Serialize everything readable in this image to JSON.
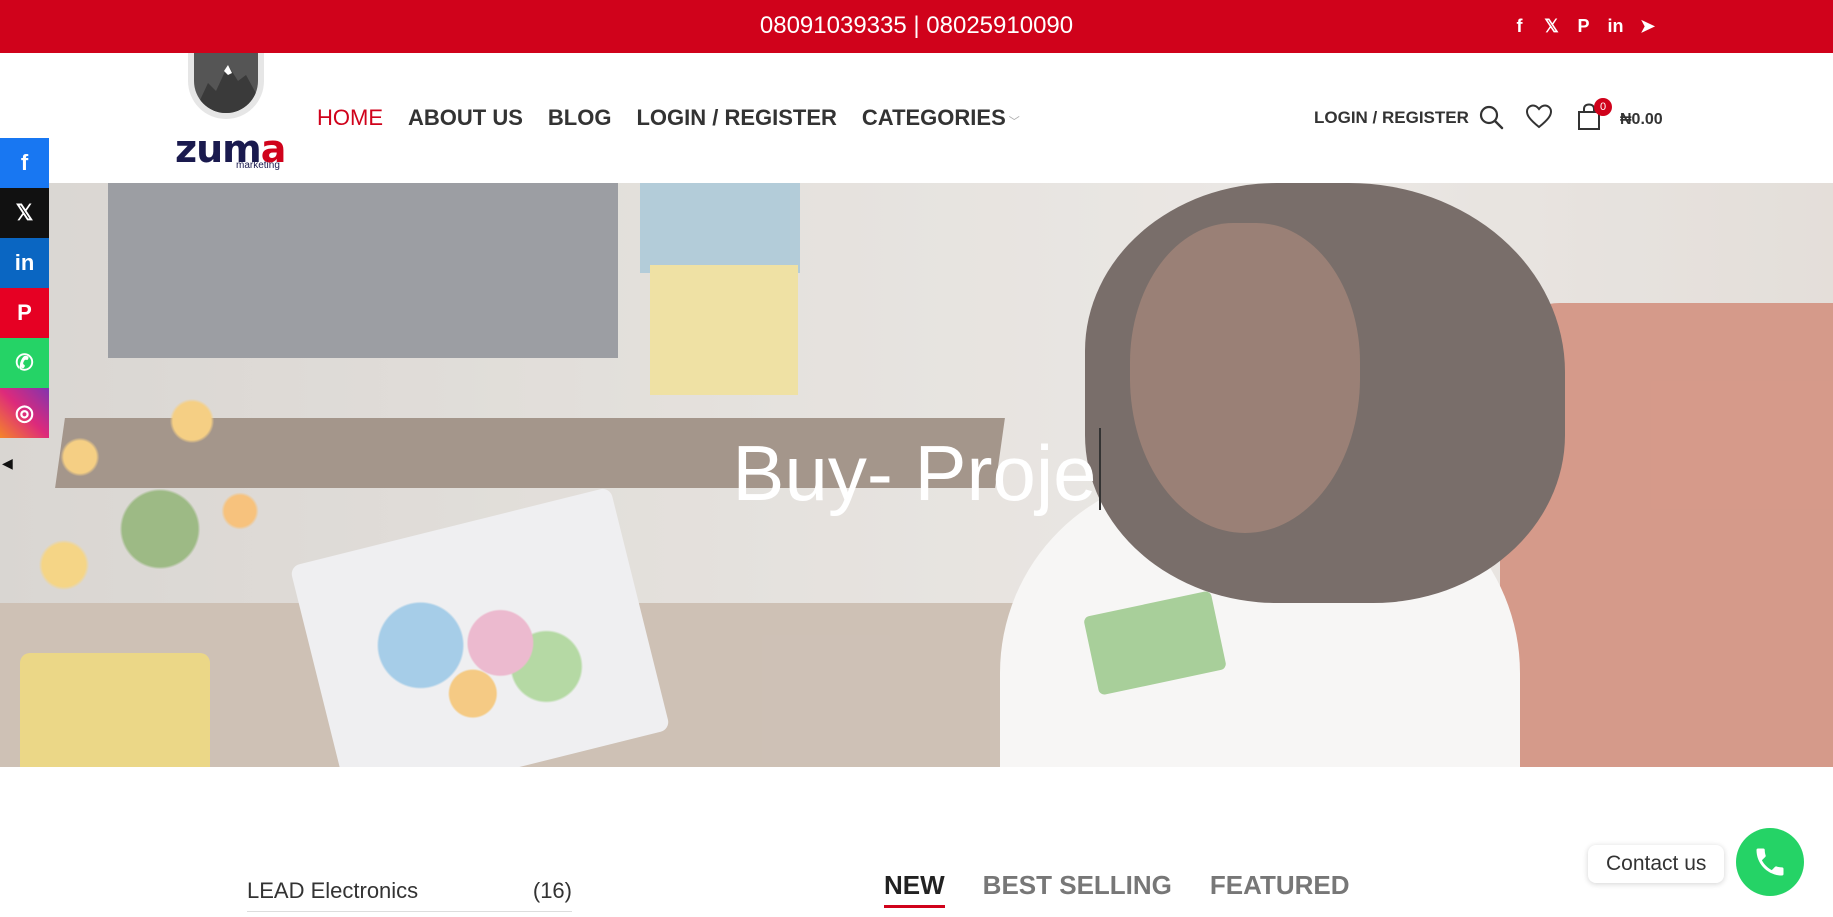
{
  "topbar": {
    "phones": "08091039335 | 08025910090",
    "social": [
      {
        "icon": "facebook-icon",
        "glyph": "f"
      },
      {
        "icon": "x-icon",
        "glyph": "𝕏"
      },
      {
        "icon": "pinterest-icon",
        "glyph": "P"
      },
      {
        "icon": "linkedin-icon",
        "glyph": "in"
      },
      {
        "icon": "telegram-icon",
        "glyph": "➤"
      }
    ],
    "background": "#d0021b"
  },
  "logo": {
    "wordmark_start": "zum",
    "wordmark_end": "a",
    "subtitle": "marketing"
  },
  "nav": {
    "items": [
      {
        "label": "HOME",
        "active": true
      },
      {
        "label": "ABOUT US"
      },
      {
        "label": "BLOG"
      },
      {
        "label": "LOGIN / REGISTER"
      },
      {
        "label": "CATEGORIES"
      }
    ]
  },
  "header": {
    "login_label": "LOGIN / REGISTER",
    "cart_count": "0",
    "cart_total": "₦0.00"
  },
  "hero": {
    "title": "Buy- Proje"
  },
  "sharebar": [
    {
      "icon": "facebook-icon",
      "glyph": "f"
    },
    {
      "icon": "x-icon",
      "glyph": "𝕏"
    },
    {
      "icon": "linkedin-icon",
      "glyph": "in"
    },
    {
      "icon": "pinterest-icon",
      "glyph": "P"
    },
    {
      "icon": "whatsapp-icon",
      "glyph": "✆"
    },
    {
      "icon": "instagram-icon",
      "glyph": "◎"
    }
  ],
  "categories": [
    {
      "name": "LEAD Electronics",
      "count": "(16)"
    }
  ],
  "product_tabs": [
    {
      "label": "NEW",
      "active": true
    },
    {
      "label": "BEST SELLING"
    },
    {
      "label": "FEATURED"
    }
  ],
  "contact": {
    "label": "Contact us",
    "accent": "#25d366"
  }
}
